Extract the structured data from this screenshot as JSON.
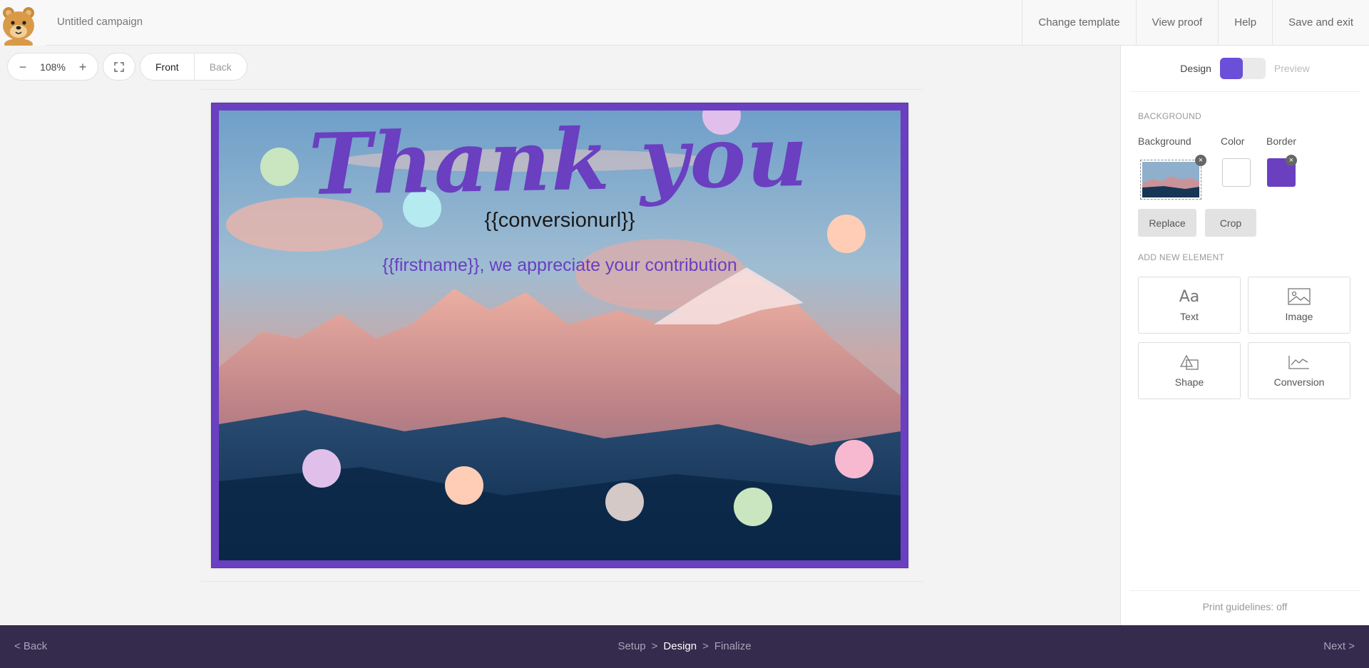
{
  "header": {
    "campaign_title": "Untitled campaign",
    "nav": [
      "Change template",
      "View proof",
      "Help",
      "Save and exit"
    ]
  },
  "toolbar": {
    "zoom_minus": "−",
    "zoom_value": "108%",
    "zoom_plus": "+",
    "side_front": "Front",
    "side_back": "Back"
  },
  "card": {
    "headline": "Thank you",
    "conversion_url": "{{conversionurl}}",
    "message": "{{firstname}}, we appreciate your contribution",
    "border_color": "#6a3fc0",
    "dot_colors": [
      "#c9e6c0",
      "#b4eaf0",
      "#e0c0ea",
      "#ffcdb5",
      "#f7b9d0",
      "#d4c9c6"
    ]
  },
  "panel": {
    "mode_design": "Design",
    "mode_preview": "Preview",
    "section_background": "BACKGROUND",
    "label_background": "Background",
    "label_color": "Color",
    "label_border": "Border",
    "remove_glyph": "×",
    "btn_replace": "Replace",
    "btn_crop": "Crop",
    "section_add": "ADD NEW ELEMENT",
    "tiles": [
      "Text",
      "Image",
      "Shape",
      "Conversion"
    ],
    "text_tile_glyph": "Aa",
    "print_guidelines": "Print guidelines: off",
    "color_swatch": "#ffffff",
    "border_swatch": "#6a3fc0"
  },
  "footer": {
    "back": "< Back",
    "steps": [
      "Setup",
      "Design",
      "Finalize"
    ],
    "current_step": "Design",
    "separator": ">",
    "next": "Next >"
  }
}
